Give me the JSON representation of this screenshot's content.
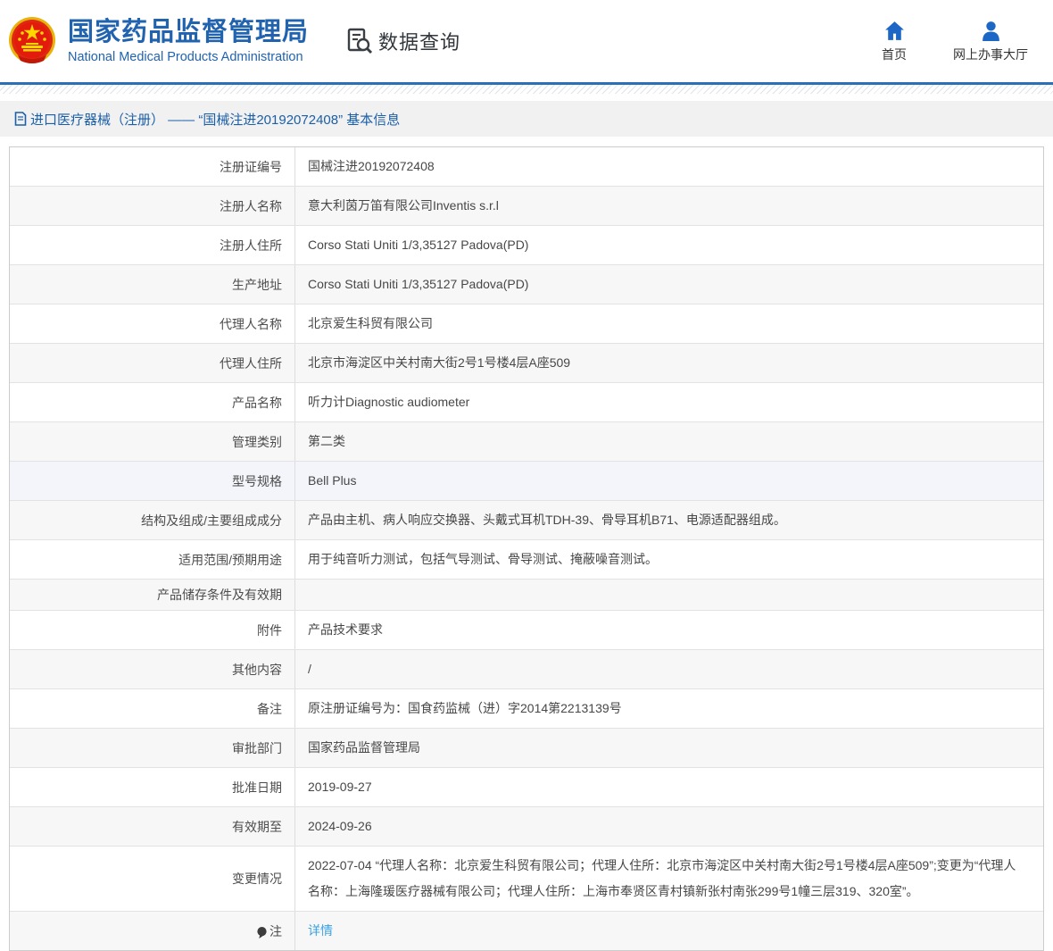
{
  "header": {
    "title": "国家药品监督管理局",
    "subtitle": "National Medical Products Administration",
    "section_label": "数据查询",
    "nav": [
      {
        "label": "首页",
        "icon": "home-icon"
      },
      {
        "label": "网上办事大厅",
        "icon": "person-icon"
      }
    ]
  },
  "breadcrumb": {
    "text": "进口医疗器械（注册） —— “国械注进20192072408” 基本信息"
  },
  "table": {
    "rows": [
      {
        "label": "注册证编号",
        "value": "国械注进20192072408"
      },
      {
        "label": "注册人名称",
        "value": "意大利茵万笛有限公司Inventis s.r.l"
      },
      {
        "label": "注册人住所",
        "value": "Corso Stati Uniti 1/3,35127 Padova(PD)"
      },
      {
        "label": "生产地址",
        "value": "Corso Stati Uniti 1/3,35127 Padova(PD)"
      },
      {
        "label": "代理人名称",
        "value": "北京爱生科贸有限公司"
      },
      {
        "label": "代理人住所",
        "value": "北京市海淀区中关村南大街2号1号楼4层A座509"
      },
      {
        "label": "产品名称",
        "value": "听力计Diagnostic audiometer"
      },
      {
        "label": "管理类别",
        "value": "第二类"
      },
      {
        "label": "型号规格",
        "value": "Bell Plus"
      },
      {
        "label": "结构及组成/主要组成成分",
        "value": "产品由主机、病人响应交换器、头戴式耳机TDH-39、骨导耳机B71、电源适配器组成。"
      },
      {
        "label": "适用范围/预期用途",
        "value": "用于纯音听力测试，包括气导测试、骨导测试、掩蔽噪音测试。"
      },
      {
        "label": "产品储存条件及有效期",
        "value": ""
      },
      {
        "label": "附件",
        "value": "产品技术要求"
      },
      {
        "label": "其他内容",
        "value": "/"
      },
      {
        "label": "备注",
        "value": "原注册证编号为：国食药监械（进）字2014第2213139号"
      },
      {
        "label": "审批部门",
        "value": "国家药品监督管理局"
      },
      {
        "label": "批准日期",
        "value": "2019-09-27"
      },
      {
        "label": "有效期至",
        "value": "2024-09-26"
      },
      {
        "label": "变更情况",
        "value": "2022-07-04 “代理人名称：北京爱生科贸有限公司；代理人住所：北京市海淀区中关村南大街2号1号楼4层A座509”;变更为“代理人名称：上海隆瑗医疗器械有限公司；代理人住所：上海市奉贤区青村镇新张村南张299号1幢三层319、320室”。"
      },
      {
        "label": "注",
        "value": "详情",
        "value_is_link": true
      }
    ]
  },
  "colors": {
    "accent_blue": "#2163ae",
    "divider_blue": "#2a6fb8",
    "icon_blue": "#1c66c5",
    "link_blue": "#3ba1e3",
    "emblem_red": "#de2910",
    "emblem_gold": "#e8b30c"
  }
}
